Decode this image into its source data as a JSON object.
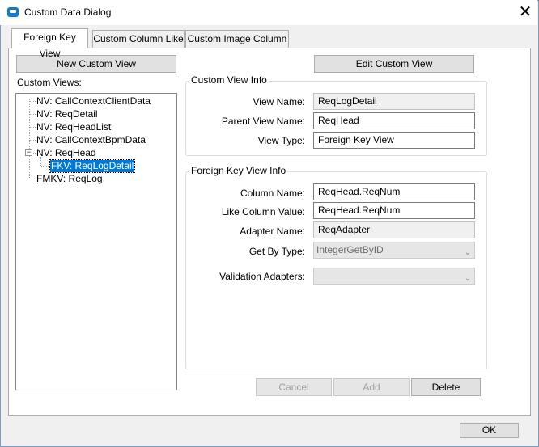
{
  "window": {
    "title": "Custom Data Dialog",
    "close_glyph": "✕",
    "ok_label": "OK"
  },
  "tabs": [
    {
      "label": "Foreign Key View",
      "active": true
    },
    {
      "label": "Custom Column Like",
      "active": false
    },
    {
      "label": "Custom Image Column",
      "active": false
    }
  ],
  "left": {
    "new_button": "New Custom View",
    "list_label": "Custom Views:",
    "tree": [
      "NV: CallContextClientData",
      "NV: ReqDetail",
      "NV: ReqHeadList",
      "NV: CallContextBpmData",
      "NV: ReqHead",
      "FKV: ReqLogDetail",
      "FMKV: ReqLog"
    ],
    "expander_glyph": "−"
  },
  "edit_button": "Edit Custom View",
  "custom_view_info": {
    "title": "Custom View Info",
    "view_name_label": "View Name:",
    "view_name": "ReqLogDetail",
    "parent_view_label": "Parent View Name:",
    "parent_view": "ReqHead",
    "view_type_label": "View Type:",
    "view_type": "Foreign Key View"
  },
  "fk_info": {
    "title": "Foreign Key View Info",
    "column_name_label": "Column Name:",
    "column_name": "ReqHead.ReqNum",
    "like_value_label": "Like Column Value:",
    "like_value": "ReqHead.ReqNum",
    "adapter_label": "Adapter Name:",
    "adapter": "ReqAdapter",
    "getby_label": "Get By Type:",
    "getby": "IntegerGetByID",
    "validation_label": "Validation Adapters:",
    "validation": ""
  },
  "actions": {
    "cancel": "Cancel",
    "add": "Add",
    "delete": "Delete"
  }
}
